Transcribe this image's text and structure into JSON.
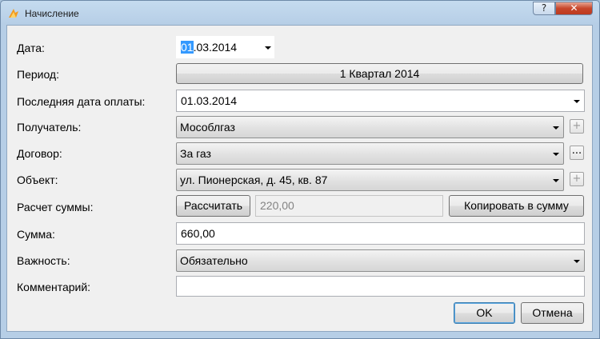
{
  "window": {
    "title": "Начисление",
    "help": "?",
    "close": "✕"
  },
  "labels": {
    "date": "Дата:",
    "period": "Период:",
    "last_pay_date": "Последняя дата оплаты:",
    "recipient": "Получатель:",
    "contract": "Договор:",
    "object": "Объект:",
    "calc_sum": "Расчет суммы:",
    "sum": "Сумма:",
    "importance": "Важность:",
    "comment": "Комментарий:"
  },
  "fields": {
    "date_selected": "01",
    "date_rest": ".03.2014",
    "period": "1 Квартал 2014",
    "last_pay_date": "01.03.2014",
    "recipient": "Мособлгаз",
    "contract": "За газ",
    "object": "ул. Пионерская, д. 45, кв. 87",
    "calc_value": "220,00",
    "sum": "660,00",
    "importance": "Обязательно",
    "comment": ""
  },
  "buttons": {
    "calculate": "Рассчитать",
    "copy_to_sum": "Копировать в  сумму",
    "plus": "+",
    "dots": "...",
    "ok": "OK",
    "cancel": "Отмена"
  }
}
